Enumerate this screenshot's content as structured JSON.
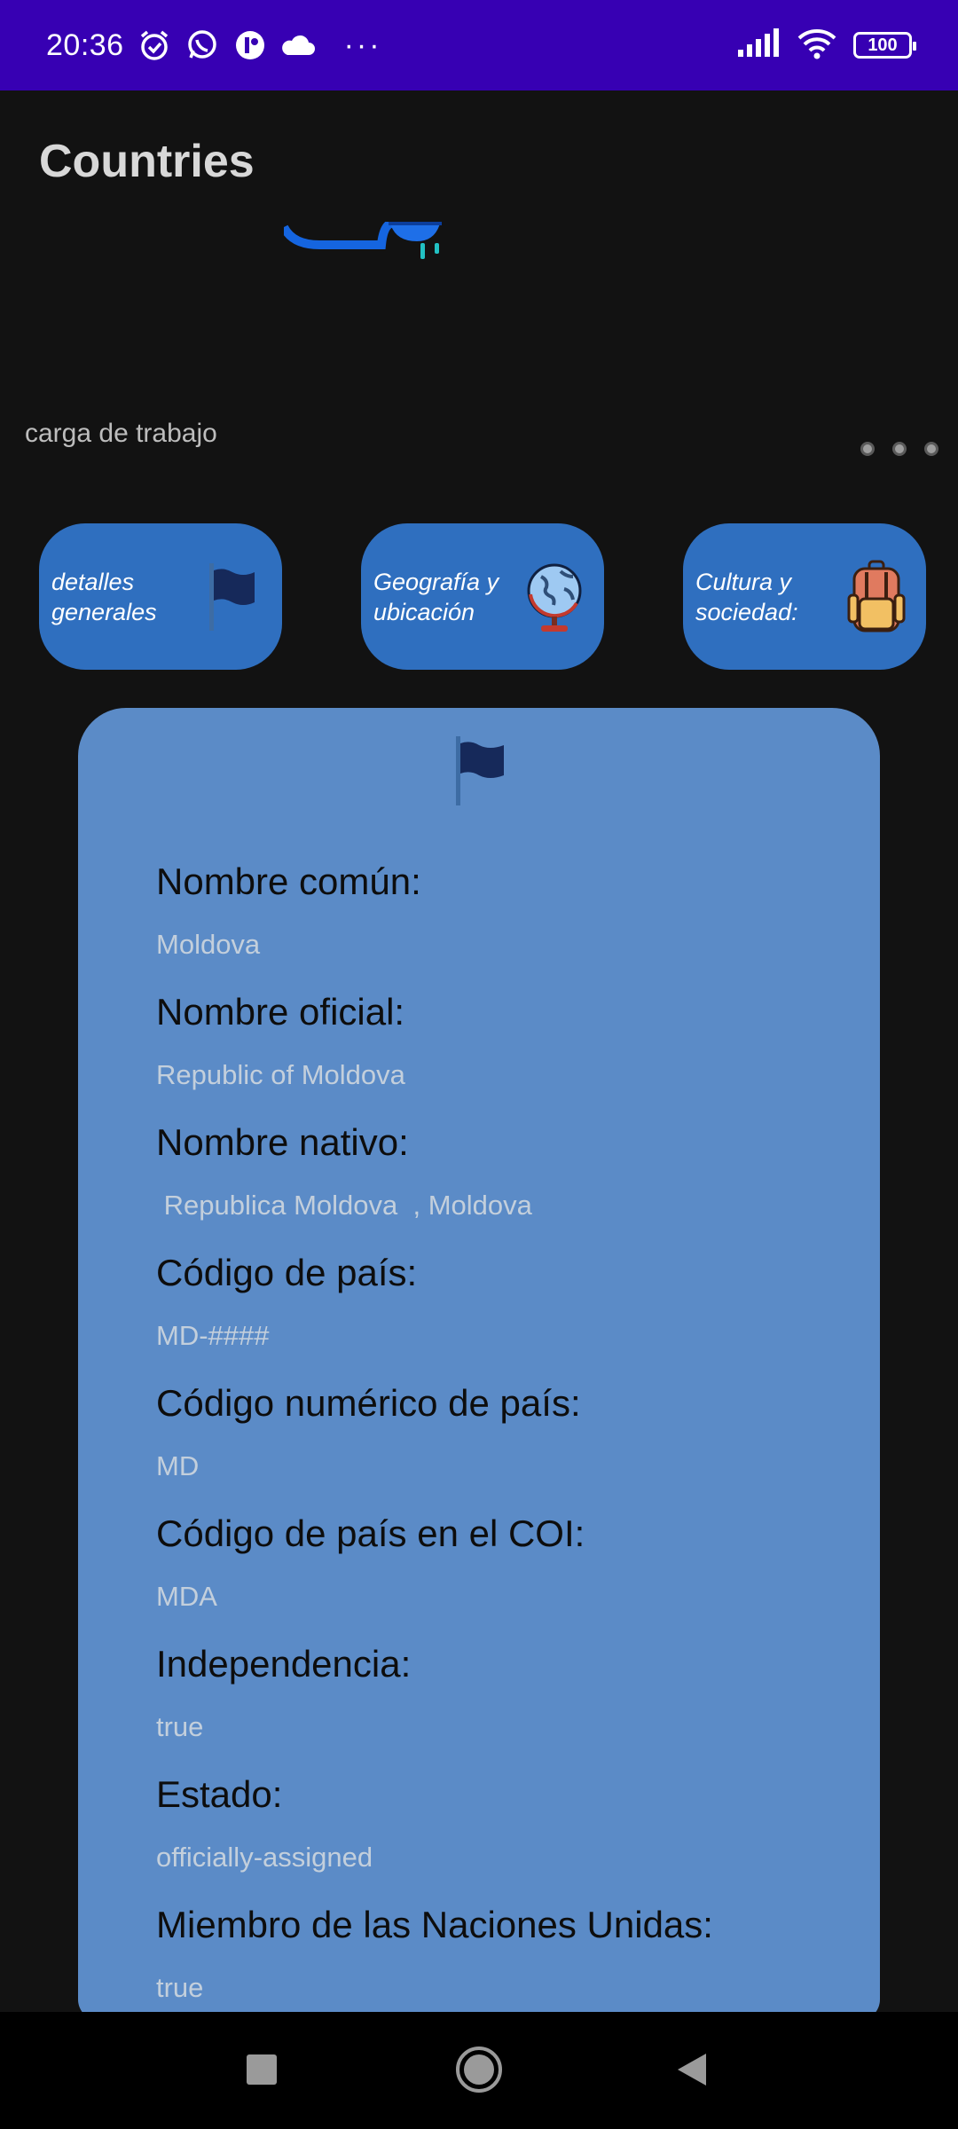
{
  "status_bar": {
    "time": "20:36",
    "battery": "100",
    "left_icons": [
      "alarm-icon",
      "whatsapp-icon",
      "app-notification-icon",
      "cloud-icon"
    ],
    "right_icons": [
      "signal-icon",
      "wifi-icon",
      "battery-icon"
    ]
  },
  "app_bar": {
    "title": "Countries"
  },
  "carousel": {
    "caption": "carga de trabajo",
    "page_count": 3
  },
  "categories": [
    {
      "label": "detalles generales",
      "icon": "flag-icon"
    },
    {
      "label": "Geografía y ubicación",
      "icon": "globe-icon"
    },
    {
      "label": "Cultura y sociedad:",
      "icon": "backpack-icon"
    }
  ],
  "details": {
    "header_icon": "flag-icon",
    "fields": [
      {
        "label": "Nombre común:",
        "value": "Moldova"
      },
      {
        "label": "Nombre oficial:",
        "value": "Republic of Moldova"
      },
      {
        "label": "Nombre nativo:",
        "value": " Republica Moldova  , Moldova"
      },
      {
        "label": "Código de país:",
        "value": "MD-####"
      },
      {
        "label": "Código numérico de país:",
        "value": "MD"
      },
      {
        "label": "Código de país en el COI:",
        "value": "MDA"
      },
      {
        "label": "Independencia:",
        "value": "true"
      },
      {
        "label": "Estado:",
        "value": "officially-assigned"
      },
      {
        "label": "Miembro de las Naciones Unidas:",
        "value": "true"
      }
    ]
  },
  "colors": {
    "status_bar": "#3700b3",
    "background": "#121212",
    "category_button": "#2f6fbf",
    "card": "#5b8bc7"
  },
  "nav_bar": {
    "buttons": [
      "recents-square-icon",
      "home-circle-icon",
      "back-triangle-icon"
    ]
  }
}
